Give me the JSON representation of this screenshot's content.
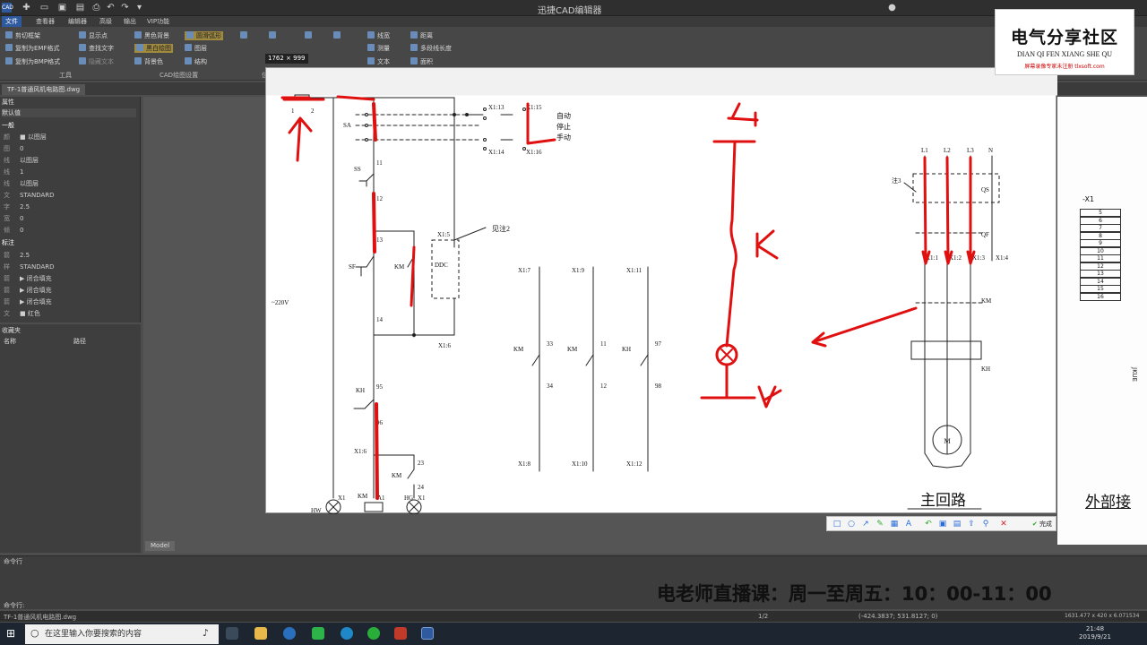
{
  "app": {
    "title": "迅捷CAD编辑器",
    "menu_tabs": [
      "文件",
      "查看器",
      "编辑器",
      "高级",
      "输出",
      "VIP功能"
    ]
  },
  "ribbon": {
    "tools": {
      "cut_frame": "剪切框架",
      "copy_emf": "复制为EMF格式",
      "copy_bmp": "复制为BMP格式",
      "show_points": "显示点",
      "find_text": "查找文字",
      "hide_text": "隐藏文本",
      "black_bg": "黑色背景",
      "black_white": "黑白绘图",
      "bg_color": "背景色",
      "smooth_arc": "圆滑弧形",
      "layers": "图层",
      "structure": "结构",
      "lineweight": "线宽",
      "measure": "测量",
      "text": "文本",
      "distance": "距离",
      "polyline_length": "多段线长度",
      "area": "面积"
    },
    "groups": {
      "tools": "工具",
      "cad_settings": "CAD绘图设置",
      "position": "位置",
      "browse": "浏览",
      "hide": "隐藏",
      "measure": "测量"
    },
    "size_tip": "1762 × 999"
  },
  "document": {
    "tab": "TF-1普通风机电路图.dwg",
    "model_tab": "Model"
  },
  "properties": {
    "title": "属性",
    "default": "默认值",
    "section_general": "一般",
    "rows": [
      {
        "k": "颜",
        "v": "■ 以图层"
      },
      {
        "k": "图",
        "v": "0"
      },
      {
        "k": "线",
        "v": "以图层"
      },
      {
        "k": "线",
        "v": "1"
      },
      {
        "k": "线",
        "v": "以图层"
      },
      {
        "k": "文",
        "v": "STANDARD"
      },
      {
        "k": "字",
        "v": "2.5"
      },
      {
        "k": "宽",
        "v": "0"
      },
      {
        "k": "倾",
        "v": "0"
      }
    ],
    "section_mark": "标注",
    "rows2": [
      {
        "k": "箭",
        "v": "2.5"
      },
      {
        "k": "样",
        "v": "STANDARD"
      },
      {
        "k": "箭",
        "v": "▶ 闭合填充"
      },
      {
        "k": "箭",
        "v": "▶ 闭合填充"
      },
      {
        "k": "箭",
        "v": "▶ 闭合填充"
      },
      {
        "k": "文",
        "v": "■ 红色"
      }
    ]
  },
  "favorites": {
    "title": "收藏夹",
    "col_name": "名称",
    "col_path": "路径"
  },
  "drawing": {
    "labels": {
      "t1": "1",
      "t2": "2",
      "sa": "SA",
      "x113": "X1:13",
      "x115": "X1:15",
      "x114": "X1:14",
      "x116": "X1:16",
      "auto": "自动",
      "stop": "停止",
      "manual": "手动",
      "n11": "11",
      "ss": "SS",
      "n12": "12",
      "n13": "13",
      "sf": "SF",
      "km": "KM",
      "n14": "14",
      "x15": "X1:5",
      "ddc": "DDC",
      "see2": "见注2",
      "x16": "X1:6",
      "v220": "~220V",
      "kh": "KH",
      "n95": "95",
      "n96": "96",
      "x16b": "X1:6",
      "km2": "KM",
      "n23": "23",
      "n24": "24",
      "hw": "HW",
      "x1a": "X1",
      "x2a": "X2",
      "km3": "KM",
      "a1": "A1",
      "a2": "A2",
      "hg": "HG",
      "x1b": "X1",
      "x2b": "X2",
      "x14": "X1:4",
      "x17": "X1:7",
      "x19": "X1:9",
      "x111": "X1:11",
      "kmA": "KM",
      "n33": "33",
      "n34": "34",
      "kmB": "KM",
      "n11b": "11",
      "n12b": "12",
      "khC": "KH",
      "n97": "97",
      "n98": "98",
      "x18": "X1:8",
      "x110": "X1:10",
      "x112": "X1:12",
      "l1": "L1",
      "l2": "L2",
      "l3": "L3",
      "nn": "N",
      "note3": "注3",
      "qs": "QS",
      "qf": "QF",
      "x11": "X1:1",
      "x12": "X1:2",
      "x13": "X1:3",
      "x14b": "X1:4",
      "kmM": "KM",
      "khM": "KH",
      "motor": "M",
      "main_circuit": "主回路",
      "external": "外部接"
    },
    "terminal_header": "-X1",
    "terminal_rows": [
      "5",
      "6",
      "7",
      "8",
      "9",
      "10",
      "11",
      "12",
      "13",
      "14",
      "15",
      "16"
    ],
    "side_text": "JKUE",
    "handwritten": {
      "l": "L",
      "k": "K",
      "n": "N"
    }
  },
  "annotation_toolbar": {
    "done": "完成"
  },
  "command": {
    "label": "命令行",
    "label2": "命令行:"
  },
  "status": {
    "file": "TF-1普通风机电路图.dwg",
    "page": "1/2",
    "coords": "(-424.3837; 531.8127; 0)",
    "size": "1631.477 x 420 x 6.071534"
  },
  "taskbar": {
    "search_placeholder": "在这里输入你要搜索的内容",
    "time": "21:48",
    "date": "2019/9/21"
  },
  "watermark": {
    "title": "电气分享社区",
    "pinyin": "DIAN QI FEN XIANG SHE QU",
    "url": "屏幕录像专家未注册 tlxsoft.com"
  },
  "banner": "电老师直播课：周一至周五：10：00-11：00",
  "colors": {
    "annotation_red": "#e01010",
    "accent_blue": "#2b6bd6"
  }
}
